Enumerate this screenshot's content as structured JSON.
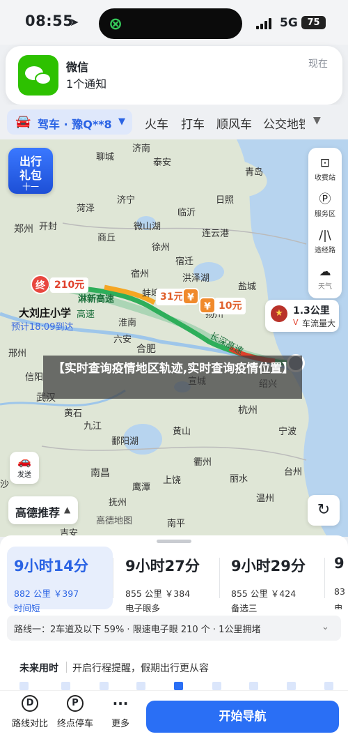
{
  "status": {
    "time": "08:55",
    "network": "5G",
    "battery": "75"
  },
  "notification": {
    "app": "微信",
    "body": "1个通知",
    "time": "现在"
  },
  "modes": {
    "drive": "驾车 · 豫Q**8",
    "items": [
      "火车",
      "打车",
      "顺风车",
      "公交地铁"
    ]
  },
  "map": {
    "gift": {
      "l1": "出行",
      "l2": "礼包",
      "l3": "十一"
    },
    "tools": [
      {
        "icon": "toll-station-icon",
        "label": "收费站"
      },
      {
        "icon": "service-area-icon",
        "label": "服务区"
      },
      {
        "icon": "route-road-icon",
        "label": "途经路"
      },
      {
        "icon": "weather-icon",
        "label": "天气"
      }
    ],
    "cities": [
      "济南",
      "青岛",
      "聊城",
      "泰安",
      "日照",
      "菏泽",
      "济宁",
      "临沂",
      "郑州",
      "开封",
      "商丘",
      "徐州",
      "连云港",
      "微山湖",
      "宿州",
      "宿迁",
      "蚌埠",
      "洪泽湖",
      "盐城",
      "淮南",
      "扬州",
      "六安",
      "合肥",
      "武汉",
      "黄石",
      "九江",
      "鄱阳湖",
      "南昌",
      "鹰潭",
      "抚州",
      "吉安",
      "上饶",
      "衢州",
      "黄山",
      "宣城",
      "杭州",
      "宁波",
      "丽水",
      "温州",
      "南平",
      "宁德",
      "长沙",
      "沙",
      "邢州",
      "信阳",
      "滁州",
      "上海",
      "绍兴",
      "台州"
    ],
    "roads": [
      "淋新高速",
      "高速",
      "长深高速"
    ],
    "end_label": "终",
    "end_cost": "210元",
    "destination": "大刘庄小学",
    "eta": "预计18:09到达",
    "tolls": [
      "31元",
      "10元"
    ],
    "traffic": {
      "distance": "1.3公里",
      "badge": "V",
      "text": "车流量大"
    },
    "banner": "【实时查询疫情地区轨迹,实时查询疫情位置】",
    "share_label": "发送",
    "gaode": "高德推荐",
    "watermark": "高德地图"
  },
  "routes": [
    {
      "time": "9小时14分",
      "meta": "882 公里 ￥397",
      "tag": "时间短"
    },
    {
      "time": "9小时27分",
      "meta": "855 公里 ￥384",
      "tag": "电子眼多"
    },
    {
      "time": "9小时29分",
      "meta": "855 公里 ￥424",
      "tag": "备选三"
    },
    {
      "time": "9",
      "meta": "83",
      "tag": "电"
    }
  ],
  "route_info": "路线一：2车道及以下 59% · 限速电子眼 210 个 · 1公里拥堵",
  "future": {
    "label": "未来用时",
    "text": "开启行程提醒，假期出行更从容"
  },
  "bottom": {
    "compare": "路线对比",
    "parking": "终点停车",
    "more": "更多",
    "navigate": "开始导航"
  },
  "colors": {
    "accent": "#2a6ff5",
    "route_green": "#2eae5a",
    "toll_orange": "#f08a2c",
    "end_red": "#e8473f"
  }
}
